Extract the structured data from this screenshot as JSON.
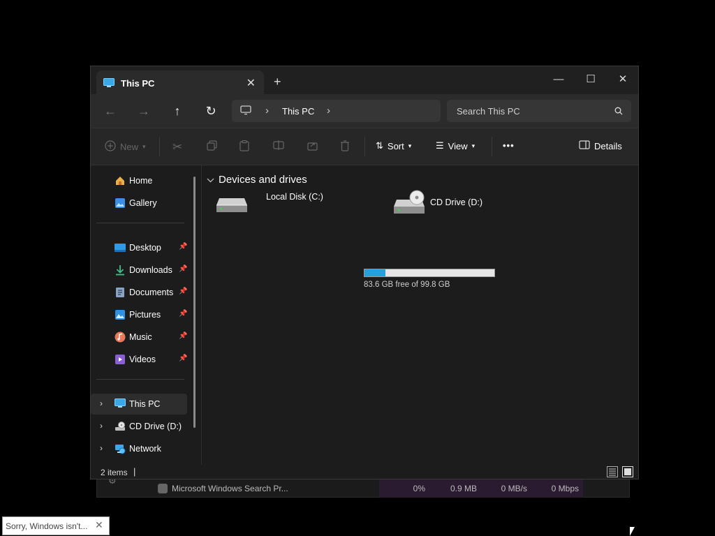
{
  "background_task": {
    "process_name": "Microsoft Windows Search Pr...",
    "cpu": "0%",
    "memory": "0.9 MB",
    "disk": "0 MB/s",
    "network": "0 Mbps"
  },
  "window": {
    "tab_title": "This PC",
    "new_tab_label": "+",
    "controls": {
      "minimize": "—",
      "maximize": "☐",
      "close": "✕"
    }
  },
  "navbar": {
    "breadcrumb": [
      "This PC"
    ],
    "search_placeholder": "Search This PC"
  },
  "toolbar": {
    "new_label": "New",
    "sort_label": "Sort",
    "view_label": "View",
    "more_label": "•••",
    "details_label": "Details"
  },
  "sidebar": {
    "top": [
      {
        "label": "Home",
        "icon": "home-icon"
      },
      {
        "label": "Gallery",
        "icon": "gallery-icon"
      }
    ],
    "quick_access": [
      {
        "label": "Desktop",
        "icon": "desktop-icon"
      },
      {
        "label": "Downloads",
        "icon": "downloads-icon"
      },
      {
        "label": "Documents",
        "icon": "documents-icon"
      },
      {
        "label": "Pictures",
        "icon": "pictures-icon"
      },
      {
        "label": "Music",
        "icon": "music-icon"
      },
      {
        "label": "Videos",
        "icon": "videos-icon"
      }
    ],
    "locations": [
      {
        "label": "This PC",
        "icon": "this-pc-icon",
        "selected": true
      },
      {
        "label": "CD Drive (D:)",
        "icon": "cd-drive-icon"
      },
      {
        "label": "Network",
        "icon": "network-icon"
      }
    ]
  },
  "content": {
    "group_header": "Devices and drives",
    "drives": [
      {
        "name": "Local Disk (C:)",
        "free_text": "83.6 GB free of 99.8 GB",
        "used_fraction": 0.162
      },
      {
        "name": "CD Drive (D:)"
      }
    ]
  },
  "statusbar": {
    "item_count": "2 items",
    "separator": "|"
  },
  "toast": {
    "text": "Sorry, Windows isn't...",
    "close": "✕"
  },
  "colors": {
    "accent": "#26a0da",
    "window_bg": "#1c1c1c",
    "toolbar_bg": "#272727",
    "usage_bar_bg": "#e6e6e6"
  }
}
